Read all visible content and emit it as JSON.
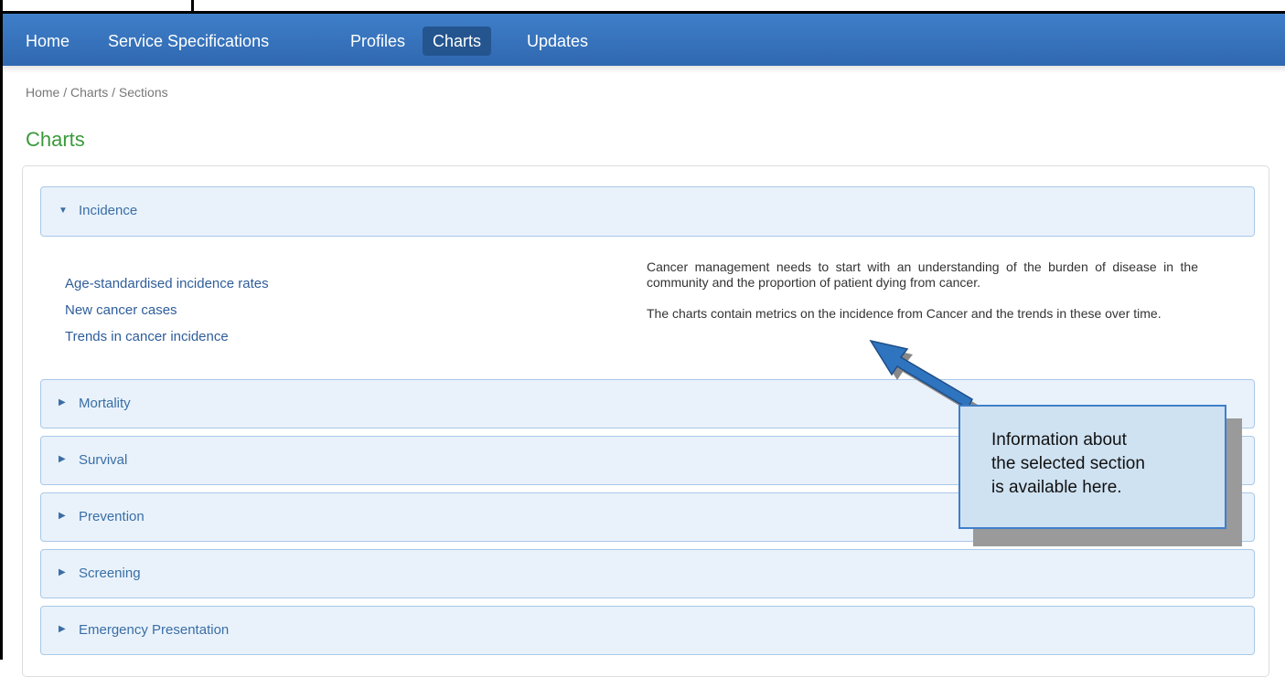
{
  "nav": {
    "items": [
      {
        "label": "Home",
        "active": false
      },
      {
        "label": "Service Specifications",
        "active": false
      },
      {
        "label": "Profiles",
        "active": false
      },
      {
        "label": "Charts",
        "active": true
      },
      {
        "label": "Updates",
        "active": false
      }
    ]
  },
  "breadcrumb": "Home / Charts / Sections",
  "page_title": "Charts",
  "accordion": {
    "sections": [
      {
        "label": "Incidence",
        "expanded": true
      },
      {
        "label": "Mortality",
        "expanded": false
      },
      {
        "label": "Survival",
        "expanded": false
      },
      {
        "label": "Prevention",
        "expanded": false
      },
      {
        "label": "Screening",
        "expanded": false
      },
      {
        "label": "Emergency Presentation",
        "expanded": false
      }
    ],
    "expanded_icon": "caret-down-icon",
    "collapsed_icon": "caret-right-icon"
  },
  "incidence": {
    "links": [
      "Age-standardised incidence rates",
      "New cancer cases",
      "Trends in cancer incidence"
    ],
    "description": [
      "Cancer management needs to start with an understanding of the burden of disease in the community and the proportion of patient dying from cancer.",
      "The charts contain metrics on the incidence from Cancer and the trends in these over time."
    ]
  },
  "callout": {
    "lines": [
      "Information about",
      "the selected section",
      "is available here."
    ]
  },
  "colors": {
    "navbar": "#3373bd",
    "title_green": "#3a9a3a",
    "link_blue": "#2e5d9a",
    "accordion_bg": "#e9f2fb",
    "callout_bg": "#cfe2f2"
  }
}
